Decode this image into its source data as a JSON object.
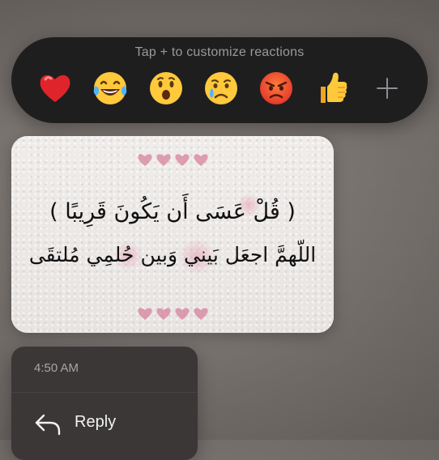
{
  "reactions": {
    "hint": "Tap + to customize reactions",
    "items": [
      {
        "name": "red-heart",
        "glyph": "❤️"
      },
      {
        "name": "tears-of-joy",
        "glyph": "😂"
      },
      {
        "name": "surprised",
        "glyph": "😮"
      },
      {
        "name": "crying",
        "glyph": "😢"
      },
      {
        "name": "angry",
        "glyph": "😡"
      },
      {
        "name": "thumbs-up",
        "glyph": "👍"
      }
    ],
    "add_symbol": "+"
  },
  "message": {
    "line1": "( قُلْ عَسَى أَن يَكُونَ قَرِيبًا )",
    "line2": "اللّهمَّ اجعَل بَيني وَبين حُلمِي مُلتقَى",
    "heart_color": "#d47b9a"
  },
  "context_menu": {
    "time": "4:50 AM",
    "reply_label": "Reply"
  },
  "colors": {
    "reaction_bar_bg": "#1e1e1f",
    "menu_bg": "#3a3736"
  }
}
